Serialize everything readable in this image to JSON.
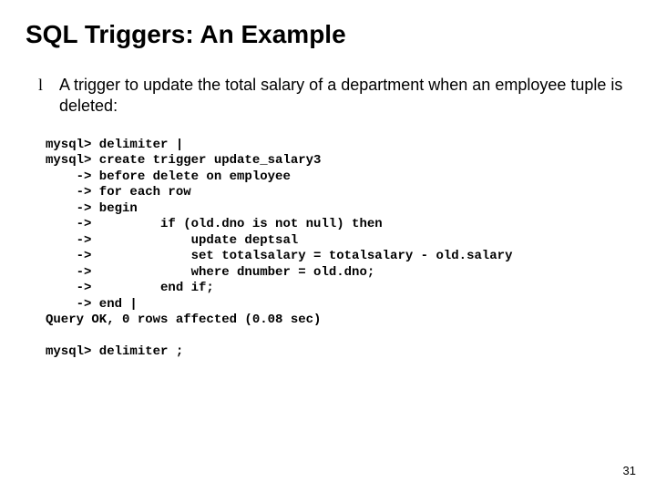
{
  "title": "SQL Triggers: An Example",
  "bullet": {
    "marker": "l",
    "text": "A trigger to update the total salary of a department when an employee tuple is deleted:"
  },
  "code": "mysql> delimiter |\nmysql> create trigger update_salary3\n    -> before delete on employee\n    -> for each row\n    -> begin\n    ->         if (old.dno is not null) then\n    ->             update deptsal\n    ->             set totalsalary = totalsalary - old.salary\n    ->             where dnumber = old.dno;\n    ->         end if;\n    -> end |\nQuery OK, 0 rows affected (0.08 sec)\n\nmysql> delimiter ;",
  "page_number": "31"
}
